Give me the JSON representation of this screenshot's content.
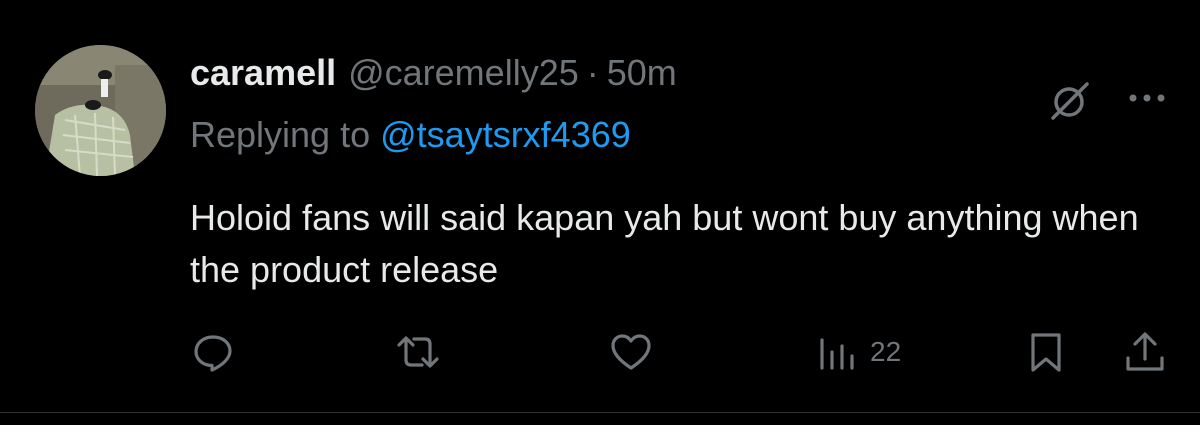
{
  "tweet": {
    "display_name": "caramell",
    "handle": "@caremelly25",
    "separator": "·",
    "time": "50m",
    "reply_prefix": "Replying to",
    "reply_to": "@tsaytsrxf4369",
    "text": "Holoid fans will said kapan yah but wont buy anything when the product release"
  },
  "actions": {
    "reply_icon": "reply-icon",
    "retweet_icon": "retweet-icon",
    "like_icon": "like-icon",
    "views_icon": "views-icon",
    "views_count": "22",
    "bookmark_icon": "bookmark-icon",
    "share_icon": "share-icon"
  },
  "header_icons": {
    "grok": "grok-icon",
    "more": "more-icon"
  },
  "colors": {
    "background": "#000000",
    "primary_text": "#e7e9ea",
    "secondary_text": "#71767b",
    "link": "#1d9bf0",
    "divider": "#2f3336"
  }
}
